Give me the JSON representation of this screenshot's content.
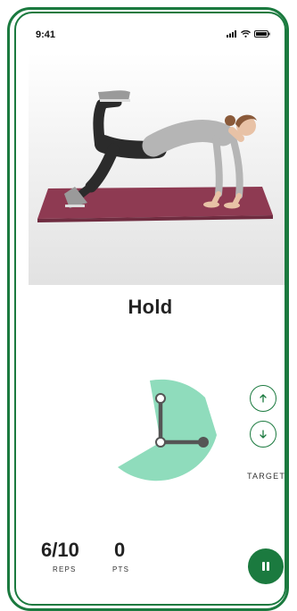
{
  "status_bar": {
    "time": "9:41",
    "icons": [
      "signal-icon",
      "wifi-icon",
      "battery-icon"
    ]
  },
  "exercise": {
    "instruction": "Hold"
  },
  "target": {
    "label": "TARGET",
    "up_icon": "arrow-up-icon",
    "down_icon": "arrow-down-icon"
  },
  "stats": {
    "reps": {
      "value": "6/10",
      "label": "REPS"
    },
    "points": {
      "value": "0",
      "label": "PTS"
    }
  },
  "controls": {
    "pause_icon": "pause-icon"
  },
  "colors": {
    "brand": "#1b7a3f",
    "gauge_fill": "#8fdcbc",
    "joint": "#555555"
  }
}
